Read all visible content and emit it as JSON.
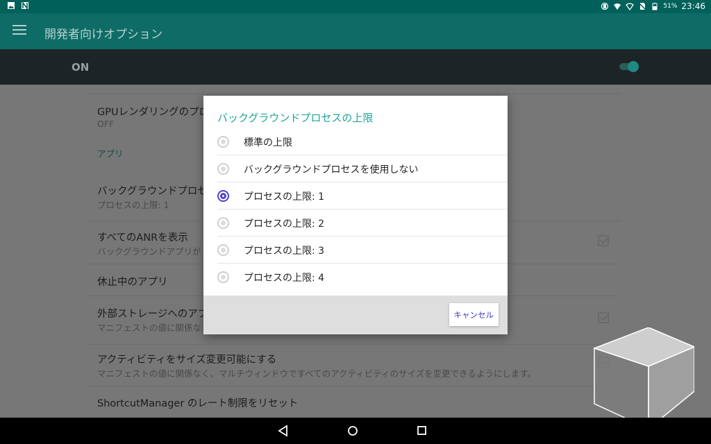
{
  "status_bar": {
    "battery": "51%",
    "time": "23:46"
  },
  "app_bar": {
    "title": "開発者向けオプション"
  },
  "master_toggle": {
    "label": "ON",
    "state": "on"
  },
  "settings": {
    "gpu_rendering": {
      "title": "GPUレンダリングのプロ",
      "summary": "OFF"
    },
    "section_apps": "アプリ",
    "background_limit": {
      "title": "バックグラウンドプロセ",
      "summary": "プロセスの上限: 1"
    },
    "show_all_anr": {
      "title": "すべてのANRを表示",
      "summary": "バックグラウンドアプリが"
    },
    "inactive_apps": {
      "title": "休止中のアプリ"
    },
    "external_storage": {
      "title": "外部ストレージへのアプ",
      "summary": "マニフェストの値に関係な"
    },
    "resizable_activities": {
      "title": "アクティビティをサイズ変更可能にする",
      "summary": "マニフェストの値に関係なく、マルチウィンドウですべてのアクティビティのサイズを変更できるようにします。"
    },
    "shortcut_manager": {
      "title": "ShortcutManager のレート制限をリセット"
    }
  },
  "dialog": {
    "title": "バックグラウンドプロセスの上限",
    "options": [
      {
        "label": "標準の上限",
        "selected": false
      },
      {
        "label": "バックグラウンドプロセスを使用しない",
        "selected": false
      },
      {
        "label": "プロセスの上限: 1",
        "selected": true
      },
      {
        "label": "プロセスの上限: 2",
        "selected": false
      },
      {
        "label": "プロセスの上限: 3",
        "selected": false
      },
      {
        "label": "プロセスの上限: 4",
        "selected": false
      }
    ],
    "cancel_label": "キャンセル"
  },
  "nav_bar": {
    "icons": [
      "back-icon",
      "home-icon",
      "recents-icon"
    ]
  },
  "colors": {
    "accent_teal": "#1ea39a",
    "radio_selected": "#4b45c7",
    "cancel_text": "#3c3dbb"
  }
}
